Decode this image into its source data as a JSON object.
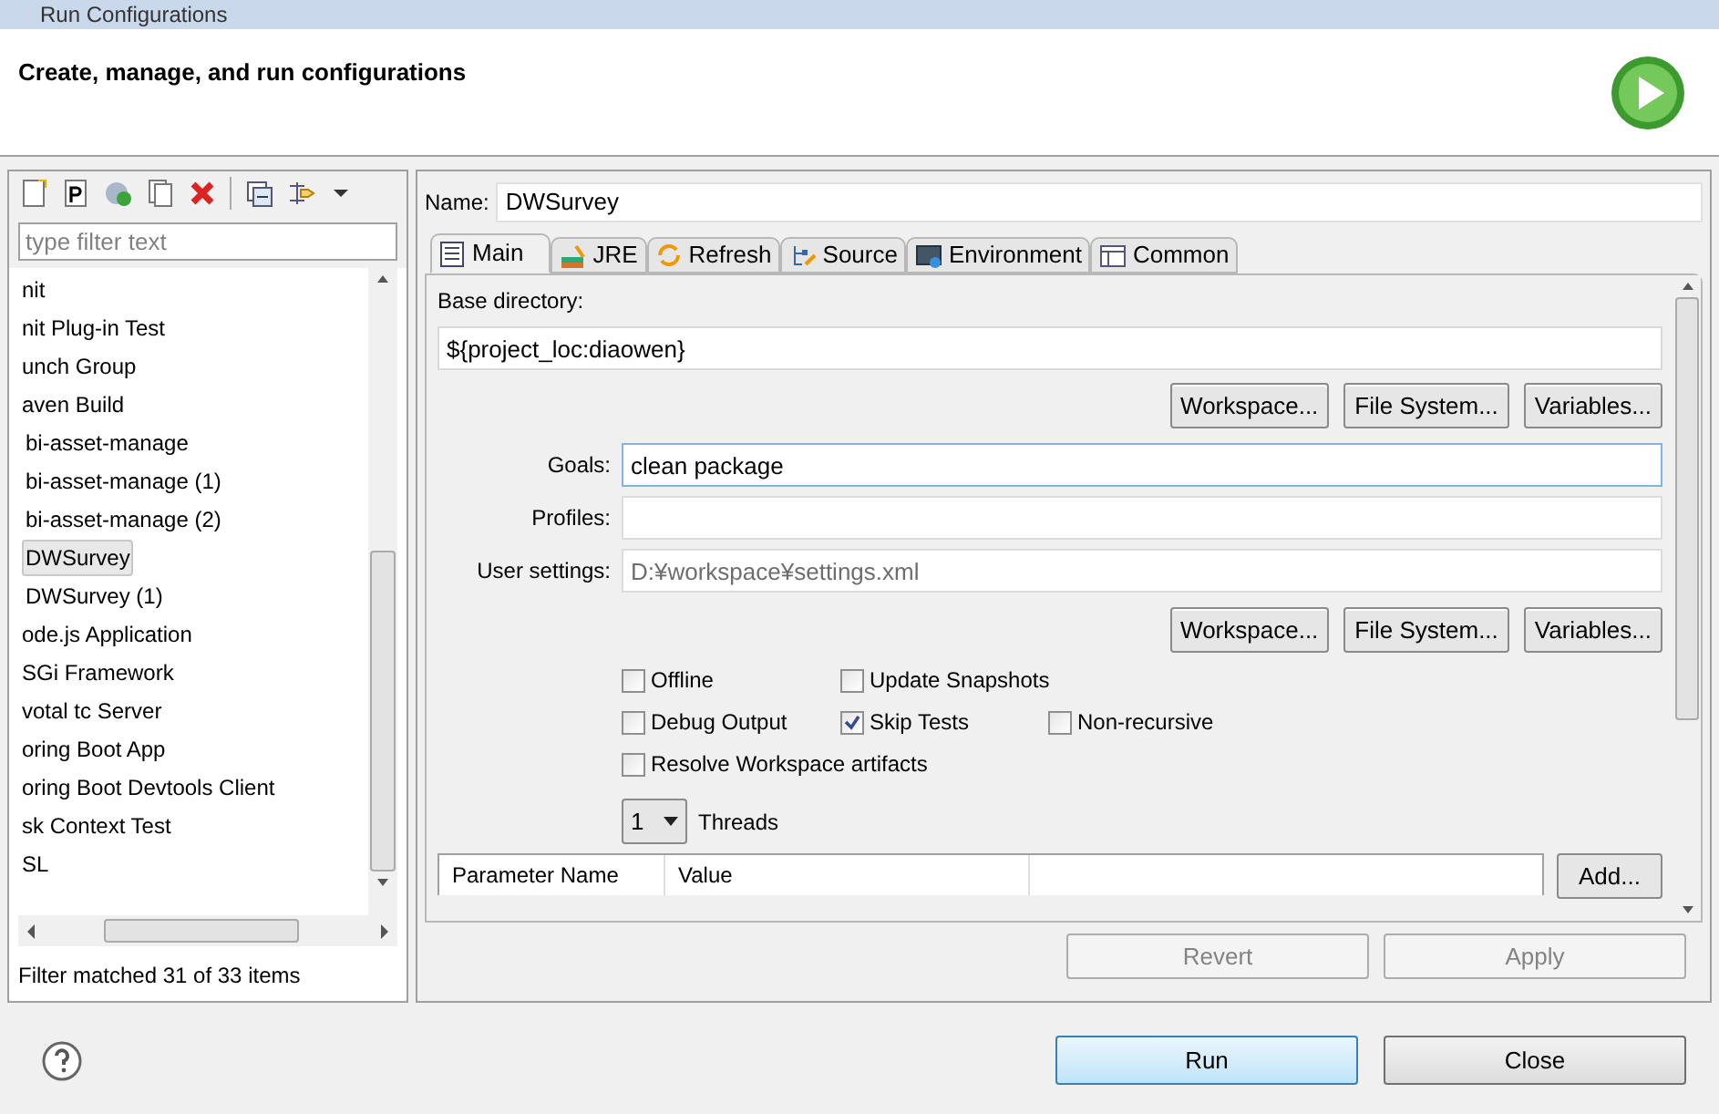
{
  "window": {
    "title": "Run Configurations"
  },
  "header": {
    "message": "Create, manage, and run configurations"
  },
  "sidebar": {
    "filter": {
      "placeholder": "type filter text"
    },
    "items": [
      {
        "label": "nit",
        "selected": false
      },
      {
        "label": "nit Plug-in Test",
        "selected": false
      },
      {
        "label": "unch Group",
        "selected": false
      },
      {
        "label": "aven Build",
        "selected": false,
        "children": [
          {
            "label": "bi-asset-manage",
            "selected": false
          },
          {
            "label": "bi-asset-manage (1)",
            "selected": false
          },
          {
            "label": "bi-asset-manage (2)",
            "selected": false
          },
          {
            "label": "DWSurvey",
            "selected": true
          },
          {
            "label": "DWSurvey (1)",
            "selected": false
          }
        ]
      },
      {
        "label": "ode.js Application",
        "selected": false
      },
      {
        "label": "SGi Framework",
        "selected": false
      },
      {
        "label": "votal tc Server",
        "selected": false
      },
      {
        "label": "oring Boot App",
        "selected": false
      },
      {
        "label": "oring Boot Devtools Client",
        "selected": false
      },
      {
        "label": "sk Context Test",
        "selected": false
      },
      {
        "label": "SL",
        "selected": false
      }
    ],
    "status": "Filter matched 31 of 33 items"
  },
  "name": {
    "label": "Name:",
    "value": "DWSurvey"
  },
  "tabs": [
    {
      "label": "Main",
      "selected": true
    },
    {
      "label": "JRE",
      "selected": false
    },
    {
      "label": "Refresh",
      "selected": false
    },
    {
      "label": "Source",
      "selected": false
    },
    {
      "label": "Environment",
      "selected": false
    },
    {
      "label": "Common",
      "selected": false
    }
  ],
  "main": {
    "base_directory": {
      "label": "Base directory:",
      "value": "${project_loc:diaowen}"
    },
    "base_buttons": [
      "Workspace...",
      "File System...",
      "Variables..."
    ],
    "fields": [
      {
        "label": "Goals:",
        "value": "clean package",
        "focused": true
      },
      {
        "label": "Profiles:",
        "focused": false
      },
      {
        "label": "User settings:",
        "placeholder": "D:¥workspace¥settings.xml",
        "focused": false
      }
    ],
    "settings_buttons": [
      "Workspace...",
      "File System...",
      "Variables..."
    ],
    "checkboxes": [
      [
        {
          "label": "Offline",
          "checked": false
        },
        {
          "label": "Update Snapshots",
          "checked": false
        }
      ],
      [
        {
          "label": "Debug Output",
          "checked": false
        },
        {
          "label": "Skip Tests",
          "checked": true
        },
        {
          "label": "Non-recursive",
          "checked": false
        }
      ],
      [
        {
          "label": "Resolve Workspace artifacts",
          "checked": false
        }
      ]
    ],
    "threads": {
      "value": "1",
      "label": "Threads"
    },
    "parameters": {
      "columns": [
        "Parameter Name",
        "Value"
      ],
      "add_button": "Add..."
    }
  },
  "action_buttons": [
    {
      "label": "Revert",
      "disabled": true
    },
    {
      "label": "Apply",
      "disabled": true
    }
  ],
  "dialog_buttons": [
    {
      "label": "Run",
      "default": true
    },
    {
      "label": "Close",
      "default": false
    }
  ]
}
